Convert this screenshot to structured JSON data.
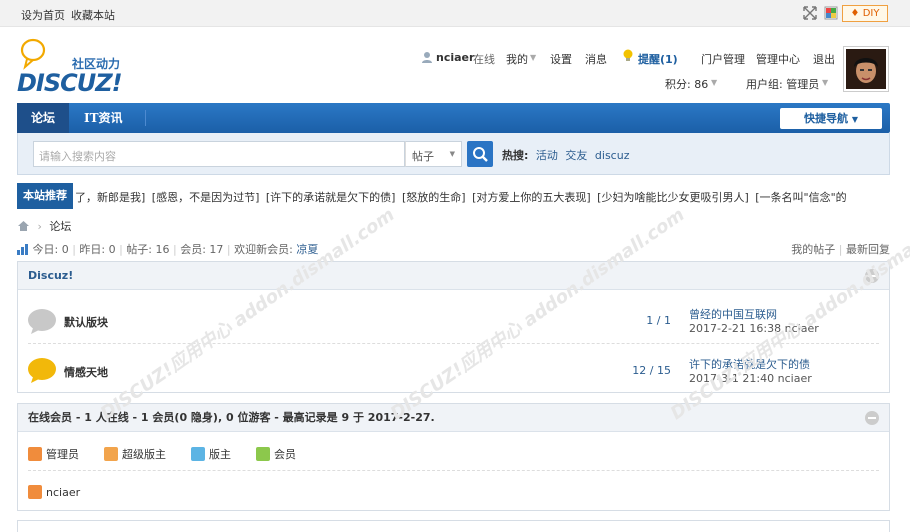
{
  "topbar": {
    "set_home": "设为首页",
    "bookmark": "收藏本站",
    "diy": "DIY"
  },
  "logo": {
    "cn": "社区动力",
    "en": "DISCUZ!"
  },
  "user": {
    "name": "nciaer",
    "status": "在线",
    "my": "我的",
    "settings": "设置",
    "messages": "消息",
    "remind": "提醒(1)",
    "portal_admin": "门户管理",
    "admin_center": "管理中心",
    "logout": "退出",
    "points_label": "积分: 86",
    "group_label": "用户组: 管理员"
  },
  "nav": {
    "items": [
      "论坛",
      "IT资讯"
    ],
    "quick_nav": "快捷导航"
  },
  "search": {
    "placeholder": "请输入搜索内容",
    "type": "帖子",
    "hot_label": "热搜:",
    "hot": [
      "活动",
      "交友",
      "discuz"
    ]
  },
  "ticker": {
    "label": "本站推荐",
    "items": [
      "了，新郎是我]",
      "[感恩，不是因为过节]",
      "[许下的承诺就是欠下的债]",
      "[怒放的生命]",
      "[对方爱上你的五大表现]",
      "[少妇为啥能比少女更吸引男人]",
      "[一条名叫\"信念\"的"
    ]
  },
  "breadcrumb": {
    "current": "论坛"
  },
  "stats": {
    "today": "今日: 0",
    "yesterday": "昨日: 0",
    "posts": "帖子: 16",
    "members": "会员: 17",
    "welcome": "欢迎新会员:",
    "new_member": "凉夏",
    "my_posts": "我的帖子",
    "latest_replies": "最新回复"
  },
  "forum_group": {
    "title": "Discuz!",
    "forums": [
      {
        "name": "默认版块",
        "count": "1 / 1",
        "last_title": "曾经的中国互联网",
        "last_time": "2017-2-21 16:38 nciaer",
        "icon_color": "#c8c8c8"
      },
      {
        "name": "情感天地",
        "count": "12 / 15",
        "last_title": "许下的承诺就是欠下的债",
        "last_time": "2017-3-1 21:40 nciaer",
        "icon_color": "#f2b80a"
      }
    ]
  },
  "online": {
    "title": "在线会员 - 1 人在线 - 1 会员(0 隐身), 0 位游客 - 最高记录是 9 于 2017-2-27.",
    "groups": [
      {
        "label": "管理员",
        "color": "#f08c3c"
      },
      {
        "label": "超级版主",
        "color": "#f2a44c"
      },
      {
        "label": "版主",
        "color": "#5cb4e4"
      },
      {
        "label": "会员",
        "color": "#8cc84c"
      }
    ],
    "users": [
      {
        "name": "nciaer",
        "color": "#f08c3c"
      }
    ]
  },
  "watermark": "DISCUZ!应用中心 addon.dismall.com"
}
